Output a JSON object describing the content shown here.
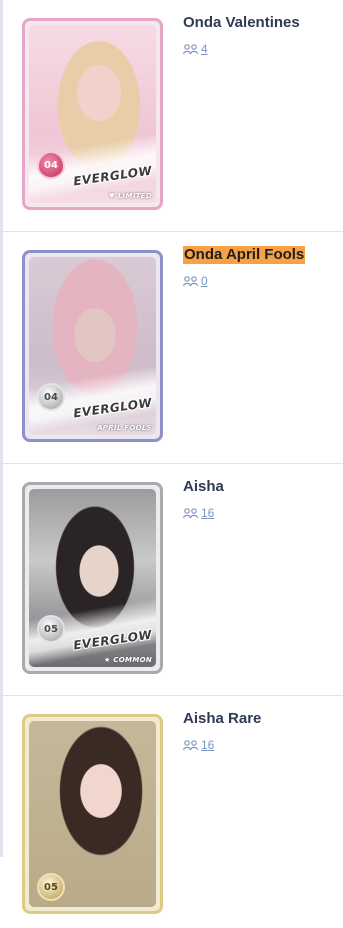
{
  "cards": [
    {
      "title": "Onda Valentines",
      "owners": "4",
      "number": "04",
      "group": "EVERGLOW",
      "rarity": "♥ LIMITED",
      "frame": "pink",
      "highlighted": false
    },
    {
      "title": "Onda April Fools",
      "owners": "0",
      "number": "04",
      "group": "EVERGLOW",
      "rarity": "APRIL FOOLS",
      "frame": "lavender",
      "highlighted": true
    },
    {
      "title": "Aisha",
      "owners": "16",
      "number": "05",
      "group": "EVERGLOW",
      "rarity": "★ COMMON",
      "frame": "silver",
      "highlighted": false
    },
    {
      "title": "Aisha Rare",
      "owners": "16",
      "number": "05",
      "frame": "gold",
      "highlighted": false
    }
  ],
  "icons": {
    "owners": "users-icon"
  },
  "colors": {
    "highlight": "#f7a145",
    "title": "#2f3a55",
    "link": "#7f96c2"
  }
}
